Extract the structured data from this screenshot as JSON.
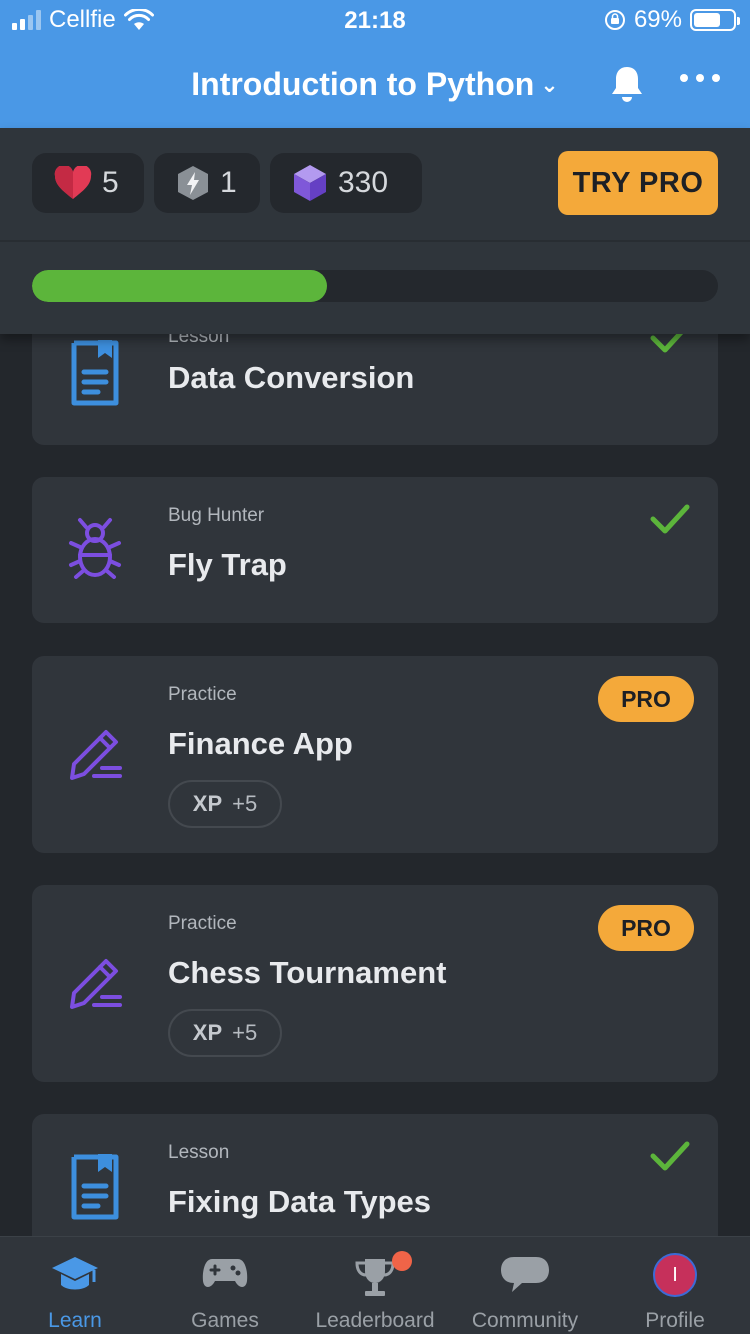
{
  "status_bar": {
    "carrier": "Cellfie",
    "time": "21:18",
    "battery": "69%",
    "battery_level": 0.69
  },
  "header": {
    "course_title": "Introduction to Python",
    "bell_icon": "bell-icon",
    "more_icon": "more-icon"
  },
  "stats": {
    "hearts": "5",
    "streak": "1",
    "gems": "330",
    "try_pro_label": "TRY PRO",
    "progress": 0.43
  },
  "colors": {
    "accent": "#4a98e6",
    "pro": "#f4a93a",
    "success": "#5cb53b",
    "lesson_icon": "#3d8fde",
    "practice_icon": "#7c4ee0"
  },
  "items": [
    {
      "kind": "Lesson",
      "name": "Data Conversion",
      "icon": "lesson-icon",
      "completed": true
    },
    {
      "kind": "Bug Hunter",
      "name": "Fly Trap",
      "icon": "bug-icon",
      "completed": true
    },
    {
      "kind": "Practice",
      "name": "Finance App",
      "icon": "practice-icon",
      "badge": "PRO",
      "xp_label": "XP",
      "xp_value": "+5"
    },
    {
      "kind": "Practice",
      "name": "Chess Tournament",
      "icon": "practice-icon",
      "badge": "PRO",
      "xp_label": "XP",
      "xp_value": "+5"
    },
    {
      "kind": "Lesson",
      "name": "Fixing Data Types",
      "icon": "lesson-icon",
      "completed": true
    }
  ],
  "tabs": [
    {
      "label": "Learn",
      "icon": "graduation-cap-icon",
      "active": true
    },
    {
      "label": "Games",
      "icon": "gamepad-icon"
    },
    {
      "label": "Leaderboard",
      "icon": "trophy-icon",
      "has_notification": true
    },
    {
      "label": "Community",
      "icon": "chat-bubble-icon"
    },
    {
      "label": "Profile",
      "icon": "avatar",
      "avatar_initial": "I"
    }
  ]
}
